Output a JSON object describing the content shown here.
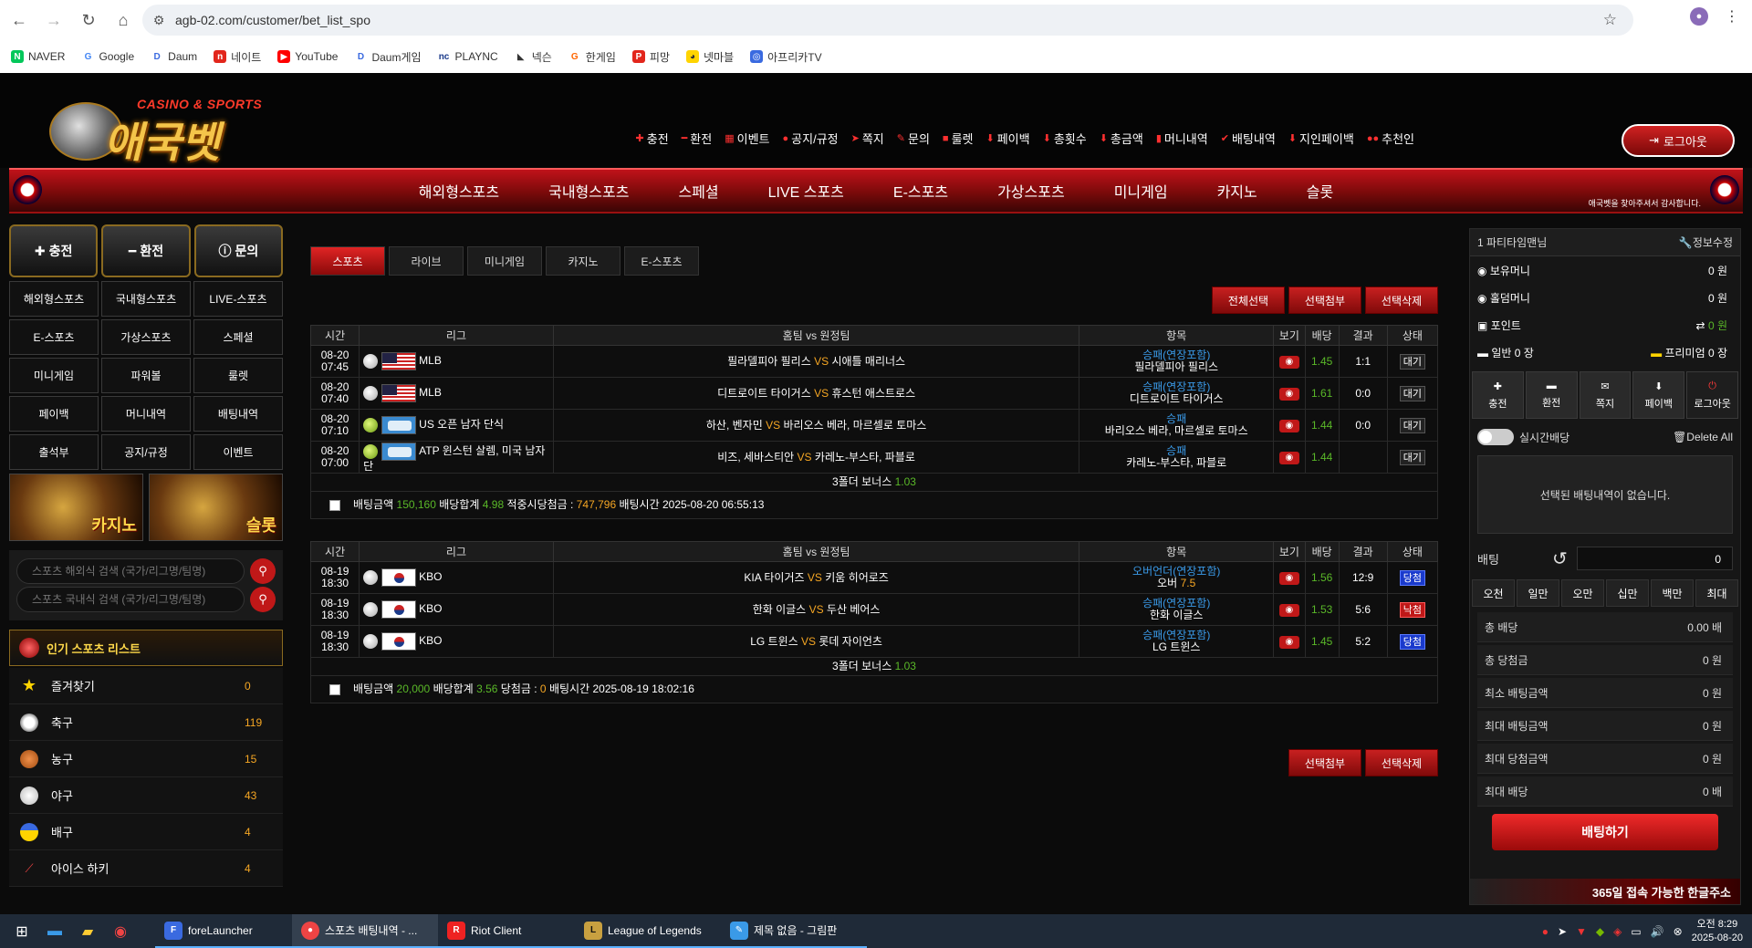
{
  "browser": {
    "url": "agb-02.com/customer/bet_list_spo",
    "bookmarks": [
      "NAVER",
      "Google",
      "Daum",
      "네이트",
      "YouTube",
      "Daum게임",
      "PLAYNC",
      "넥슨",
      "한게임",
      "피망",
      "넷마블",
      "아프리카TV"
    ]
  },
  "header": {
    "logo_sub": "CASINO & SPORTS",
    "logo_main": "애국벳",
    "top_menu": [
      "충전",
      "환전",
      "이벤트",
      "공지/규정",
      "쪽지",
      "문의",
      "룰렛",
      "페이백",
      "총횟수",
      "총금액",
      "머니내역",
      "배팅내역",
      "지인페이백",
      "추천인"
    ],
    "logout": "로그아웃"
  },
  "mainnav": {
    "items": [
      "해외형스포츠",
      "국내형스포츠",
      "스페셜",
      "LIVE 스포츠",
      "E-스포츠",
      "가상스포츠",
      "미니게임",
      "카지노",
      "슬롯"
    ],
    "sub_text": "애국벳을 찾아주셔서 감사합니다."
  },
  "left": {
    "top_buttons": [
      "충전",
      "환전",
      "문의"
    ],
    "grid": [
      "해외형스포츠",
      "국내형스포츠",
      "LIVE-스포츠",
      "E-스포츠",
      "가상스포츠",
      "스페셜",
      "미니게임",
      "파워볼",
      "룰렛",
      "페이백",
      "머니내역",
      "배팅내역",
      "출석부",
      "공지/규정",
      "이벤트"
    ],
    "banners": [
      "카지노",
      "슬롯"
    ],
    "search_overseas": "스포츠 해외식 검색 (국가/리그명/팀명)",
    "search_domestic": "스포츠 국내식 검색 (국가/리그명/팀명)",
    "popular_title": "인기 스포츠 리스트",
    "sports": [
      {
        "name": "즐겨찾기",
        "count": "0"
      },
      {
        "name": "축구",
        "count": "119"
      },
      {
        "name": "농구",
        "count": "15"
      },
      {
        "name": "야구",
        "count": "43"
      },
      {
        "name": "배구",
        "count": "4"
      },
      {
        "name": "아이스 하키",
        "count": "4"
      }
    ]
  },
  "center": {
    "tabs": [
      "스포츠",
      "라이브",
      "미니게임",
      "카지노",
      "E-스포츠"
    ],
    "actions": [
      "전체선택",
      "선택첨부",
      "선택삭제"
    ],
    "headers": [
      "시간",
      "리그",
      "홈팀 vs 원정팀",
      "항목",
      "보기",
      "배당",
      "결과",
      "상태"
    ],
    "vs": "VS",
    "bets": [
      {
        "rows": [
          {
            "date": "08-20",
            "time": "07:45",
            "sport": "baseball",
            "flag": "us",
            "league": "MLB",
            "home": "필라델피아 필리스",
            "away": "시애틀 매리너스",
            "pick_type": "승패(연장포함)",
            "pick_value": "필라델피아 필리스",
            "pick_odds": "",
            "odds": "1.45",
            "result": "1:1",
            "status": "대기",
            "status_kind": "wait"
          },
          {
            "date": "08-20",
            "time": "07:40",
            "sport": "baseball",
            "flag": "us",
            "league": "MLB",
            "home": "디트로이트 타이거스",
            "away": "휴스턴 애스트로스",
            "pick_type": "승패(연장포함)",
            "pick_value": "디트로이트 타이거스",
            "pick_odds": "",
            "odds": "1.61",
            "result": "0:0",
            "status": "대기",
            "status_kind": "wait"
          },
          {
            "date": "08-20",
            "time": "07:10",
            "sport": "tennis",
            "flag": "world",
            "league": "US 오픈 남자 단식",
            "home": "하산, 벤자민",
            "away": "바리오스 베라, 마르셀로 토마스",
            "pick_type": "승패",
            "pick_value": "바리오스 베라, 마르셀로 토마스",
            "pick_odds": "",
            "odds": "1.44",
            "result": "0:0",
            "status": "대기",
            "status_kind": "wait"
          },
          {
            "date": "08-20",
            "time": "07:00",
            "sport": "tennis",
            "flag": "world",
            "league": "ATP 윈스턴 살렘, 미국 남자 단",
            "home": "비즈, 세바스티안",
            "away": "카레노-부스타, 파블로",
            "pick_type": "승패",
            "pick_value": "카레노-부스타, 파블로",
            "pick_odds": "",
            "odds": "1.44",
            "result": "",
            "status": "대기",
            "status_kind": "wait"
          }
        ],
        "bonus_label": "3폴더 보너스",
        "bonus_value": "1.03",
        "summary": {
          "amount_label": "배팅금액",
          "amount": "150,160",
          "total_label": "배당합계",
          "total": "4.98",
          "payout_label": "적중시당첨금 :",
          "payout": "747,796",
          "time_label": "배팅시간",
          "time": "2025-08-20 06:55:13"
        }
      },
      {
        "rows": [
          {
            "date": "08-19",
            "time": "18:30",
            "sport": "baseball",
            "flag": "kr",
            "league": "KBO",
            "home": "KIA 타이거즈",
            "away": "키움 히어로즈",
            "pick_type": "오버언더(연장포함)",
            "pick_value": "오버",
            "pick_odds": "7.5",
            "odds": "1.56",
            "result": "12:9",
            "status": "당첨",
            "status_kind": "win"
          },
          {
            "date": "08-19",
            "time": "18:30",
            "sport": "baseball",
            "flag": "kr",
            "league": "KBO",
            "home": "한화 이글스",
            "away": "두산 베어스",
            "pick_type": "승패(연장포함)",
            "pick_value": "한화 이글스",
            "pick_odds": "",
            "odds": "1.53",
            "result": "5:6",
            "status": "낙첨",
            "status_kind": "lose"
          },
          {
            "date": "08-19",
            "time": "18:30",
            "sport": "baseball",
            "flag": "kr",
            "league": "KBO",
            "home": "LG 트윈스",
            "away": "롯데 자이언츠",
            "pick_type": "승패(연장포함)",
            "pick_value": "LG 트윈스",
            "pick_odds": "",
            "odds": "1.45",
            "result": "5:2",
            "status": "당첨",
            "status_kind": "win"
          }
        ],
        "bonus_label": "3폴더 보너스",
        "bonus_value": "1.03",
        "summary": {
          "amount_label": "배팅금액",
          "amount": "20,000",
          "total_label": "배당합계",
          "total": "3.56",
          "payout_label": "당첨금 :",
          "payout": "0",
          "time_label": "배팅시간",
          "time": "2025-08-19 18:02:16"
        }
      }
    ],
    "bottom_actions": [
      "선택첨부",
      "선택삭제"
    ]
  },
  "right": {
    "user": "1 파티타임맨님",
    "edit": "정보수정",
    "money_label": "보유머니",
    "money": "0 원",
    "hold_label": "홀덤머니",
    "hold": "0 원",
    "point_label": "포인트",
    "point": "0 원",
    "normal_label": "일반 0 장",
    "premium_label": "프리미엄 0 장",
    "icons": [
      "충전",
      "환전",
      "쪽지",
      "페이백",
      "로그아웃"
    ],
    "realtime": "실시간배당",
    "delete_all": "Delete All",
    "empty": "선택된 배팅내역이 없습니다.",
    "bet_label": "배팅",
    "bet_value": "0",
    "quick": [
      "오천",
      "일만",
      "오만",
      "십만",
      "백만",
      "최대"
    ],
    "totals": [
      {
        "label": "총 배당",
        "value": "0.00 배"
      },
      {
        "label": "총 당첨금",
        "value": "0 원"
      },
      {
        "label": "최소 배팅금액",
        "value": "0 원"
      },
      {
        "label": "최대 배팅금액",
        "value": "0 원"
      },
      {
        "label": "최대 당첨금액",
        "value": "0 원"
      },
      {
        "label": "최대 배당",
        "value": "0 배"
      }
    ],
    "bet_button": "배팅하기",
    "banner_text": "365일 접속 가능한 한글주소"
  },
  "taskbar": {
    "apps": [
      "foreLauncher",
      "스포츠 배팅내역 - ...",
      "Riot Client",
      "League of Legends",
      "제목 없음 - 그림판"
    ],
    "time": "오전 8:29",
    "date": "2025-08-20"
  }
}
